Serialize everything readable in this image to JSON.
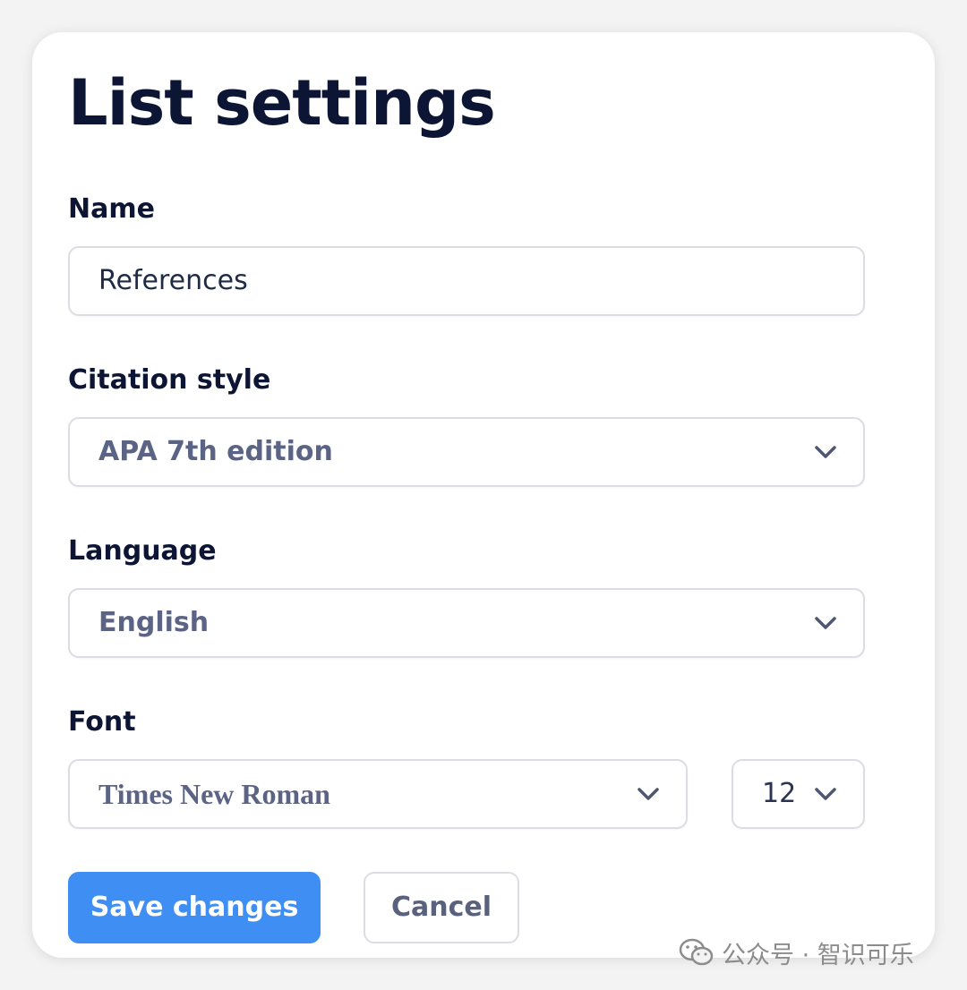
{
  "dialog": {
    "title": "List settings",
    "name": {
      "label": "Name",
      "value": "References"
    },
    "citation_style": {
      "label": "Citation style",
      "value": "APA 7th edition",
      "icon": "chevron-down-icon"
    },
    "language": {
      "label": "Language",
      "value": "English",
      "icon": "chevron-down-icon"
    },
    "font": {
      "label": "Font",
      "family": "Times New Roman",
      "size": "12",
      "icon": "chevron-down-icon"
    },
    "buttons": {
      "save": "Save changes",
      "cancel": "Cancel"
    }
  },
  "watermark": {
    "text": "公众号 · 智识可乐",
    "icon": "wechat-icon"
  },
  "colors": {
    "primary": "#3f8ef4",
    "title": "#0c1534",
    "muted_text": "#5c6485",
    "border": "#dcdde3"
  }
}
